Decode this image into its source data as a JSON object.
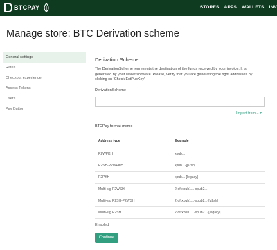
{
  "brand": {
    "name": "BTCPAY"
  },
  "nav": {
    "items": [
      "STORES",
      "APPS",
      "WALLETS",
      "INV"
    ]
  },
  "page": {
    "title": "Manage store: BTC Derivation scheme"
  },
  "sidebar": {
    "items": [
      {
        "label": "General settings",
        "active": true
      },
      {
        "label": "Rates",
        "active": false
      },
      {
        "label": "Checkout experience",
        "active": false
      },
      {
        "label": "Access Tokens",
        "active": false
      },
      {
        "label": "Users",
        "active": false
      },
      {
        "label": "Pay Button",
        "active": false
      }
    ]
  },
  "main": {
    "section_title": "Derivation Scheme",
    "description": "The DerivationScheme represents the destination of the funds received by your invoice. It is generated by your wallet software. Please, verify that you are generating the right addresses by clicking on 'Check ExtPubKey'",
    "field_label": "DerivationScheme",
    "field_value": "",
    "import_label": "Import from...",
    "format_title": "BTCPay format memo",
    "table": {
      "headers": [
        "Address type",
        "Example"
      ],
      "rows": [
        [
          "P2WPKH",
          "xpub..."
        ],
        [
          "P2SH-P2WPKH",
          "xpub...-[p2sh]"
        ],
        [
          "P2PKH",
          "xpub...-[legacy]"
        ],
        [
          "Multi-sig P2WSH",
          "2-of-xpub1...-xpub2..."
        ],
        [
          "Multi-sig P2SH-P2WSH",
          "2-of-xpub1...-xpub2...-[p2sh]"
        ],
        [
          "Multi-sig P2SH",
          "2-of-xpub1...-xpub2...-[legacy]"
        ]
      ]
    },
    "enabled_label": "Enabled",
    "continue_label": "Continue"
  },
  "colors": {
    "topbar": "#0f3b21",
    "accent": "#329f80",
    "active_bg": "#e7f3ea"
  }
}
